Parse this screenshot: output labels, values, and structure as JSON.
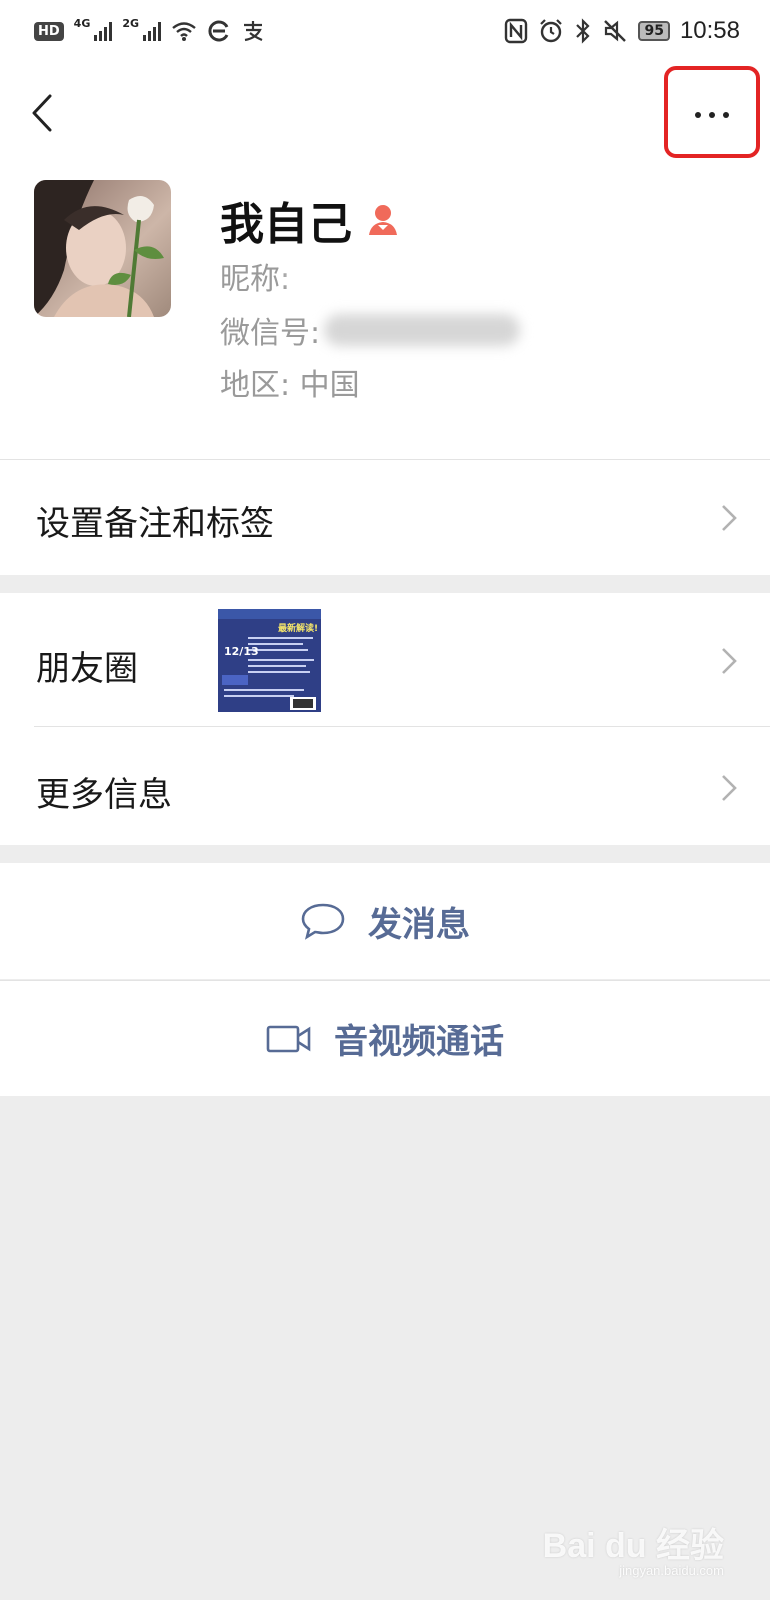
{
  "status_bar": {
    "hd": "HD",
    "network_1": "4G",
    "network_2": "2G",
    "battery": "95",
    "time": "10:58",
    "icons": [
      "hd-icon",
      "signal-icon",
      "wifi-icon",
      "browser-icon",
      "alipay-icon",
      "nfc-icon",
      "alarm-icon",
      "bluetooth-icon",
      "mute-icon",
      "battery-icon"
    ]
  },
  "header": {
    "back_icon": "chevron-left-icon",
    "more_icon": "more-dots-icon",
    "highlight_color": "#e32424"
  },
  "profile": {
    "name": "我自己",
    "gender_icon": "female-icon",
    "gender_color": "#f06a5a",
    "nickname_label": "昵称:",
    "wechat_id_label": "微信号:",
    "region_label": "地区:",
    "region_value": "中国"
  },
  "menu": {
    "remark_label": "设置备注和标签",
    "moments_label": "朋友圈",
    "more_info_label": "更多信息"
  },
  "moments_thumb": {
    "date": "12/13",
    "headline": "最新解读!"
  },
  "actions": {
    "message_label": "发消息",
    "call_label": "音视频通话",
    "accent_color": "#576b95"
  },
  "watermark": {
    "text": "Bai du 经验",
    "sub": "jingyan.baidu.com"
  }
}
